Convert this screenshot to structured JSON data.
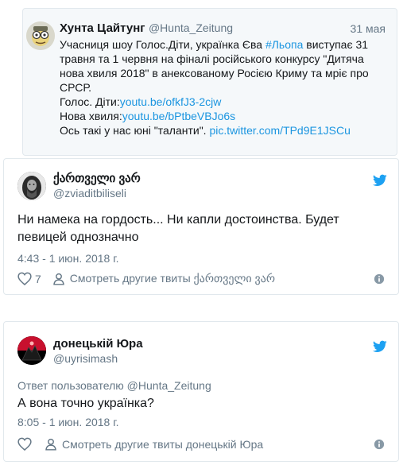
{
  "quoted_tweet": {
    "display_name": "Хунта Цайтунг",
    "handle": "@Hunta_Zeitung",
    "date": "31 мая",
    "lines": {
      "l1_a": "Учасниця шоу Голос.Діти, українка Єва ",
      "l1_hashtag": "#Льопа",
      "l1_b": " виступає 31",
      "l2": "травня та 1 червня на фіналі російського конкурсу \"Дитяча",
      "l3": "нова хвиля 2018\" в анексованому Росією Криму та мріє про",
      "l4": "СРСР.",
      "l5_a": "Голос. Діти:",
      "l5_link": "youtu.be/ofkfJ3-2cjw",
      "l6_a": "Нова хвиля:",
      "l6_link": "youtu.be/bPtbeVBJo6s",
      "l7_a": "Ось такі у нас юні \"таланти\". ",
      "l7_link": "pic.twitter.com/TPd9E1JSCu"
    }
  },
  "reply1": {
    "display_name": "ქართველი ვარ",
    "handle": "@zviaditbiliseli",
    "text_line1": "Ни намека на гордость... Ни капли достоинства. Будет",
    "text_line2": "певицей однозначно",
    "timestamp": "4:43 - 1 июн. 2018 г.",
    "likes": "7",
    "more_label": "Смотреть другие твиты ქართველი ვარ"
  },
  "reply2": {
    "display_name": "донецькій Юра",
    "handle": "@uyrisimash",
    "reply_prefix": "Ответ пользователю ",
    "reply_to": "@Hunta_Zeitung",
    "text": "А вона точно українка?",
    "timestamp": "8:05 - 1 июн. 2018 г.",
    "more_label": "Смотреть другие твиты донецькій Юра"
  },
  "colors": {
    "link": "#1b95e0",
    "muted": "#657786",
    "border": "#e1e8ed",
    "twitter_blue": "#1da1f2"
  },
  "icons": [
    "twitter-bird-icon",
    "heart-icon",
    "person-icon",
    "info-icon"
  ]
}
